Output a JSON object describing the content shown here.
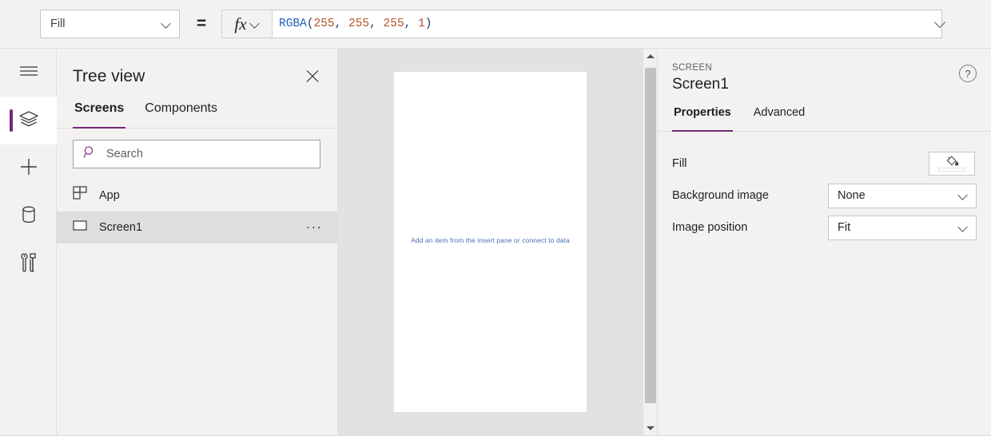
{
  "formula_bar": {
    "property_value": "Fill",
    "equals": "=",
    "fx_label": "fx",
    "formula_tokens": [
      {
        "text": "RGBA",
        "type": "fn"
      },
      {
        "text": "(",
        "type": "paren"
      },
      {
        "text": "255",
        "type": "num"
      },
      {
        "text": ", ",
        "type": "comma"
      },
      {
        "text": "255",
        "type": "num"
      },
      {
        "text": ", ",
        "type": "comma"
      },
      {
        "text": "255",
        "type": "num"
      },
      {
        "text": ", ",
        "type": "comma"
      },
      {
        "text": "1",
        "type": "num"
      },
      {
        "text": ")",
        "type": "paren"
      }
    ],
    "formula_text": "RGBA(255, 255, 255, 1)"
  },
  "rail": {
    "items": [
      {
        "icon": "hamburger-menu-icon",
        "name": "menu",
        "selected": false
      },
      {
        "icon": "layers-icon",
        "name": "tree-view",
        "selected": true
      },
      {
        "icon": "plus-icon",
        "name": "insert",
        "selected": false
      },
      {
        "icon": "database-icon",
        "name": "data",
        "selected": false
      },
      {
        "icon": "tools-icon",
        "name": "media-tools",
        "selected": false
      }
    ],
    "selection_color": "#742774"
  },
  "tree_view": {
    "title": "Tree view",
    "tabs": [
      {
        "label": "Screens",
        "active": true
      },
      {
        "label": "Components",
        "active": false
      }
    ],
    "search": {
      "placeholder": "Search",
      "value": ""
    },
    "items": [
      {
        "label": "App",
        "icon": "app-grid-icon",
        "selected": false,
        "has_menu": false
      },
      {
        "label": "Screen1",
        "icon": "screen-rect-icon",
        "selected": true,
        "has_menu": true,
        "menu_label": "..."
      }
    ]
  },
  "canvas": {
    "hint_text": "Add an item from the insert pane or connect to data",
    "hint_color": "#4871b5",
    "screen_fill": "#ffffff",
    "background": "#e3e2e1"
  },
  "properties_pane": {
    "kicker": "SCREEN",
    "title": "Screen1",
    "help_label": "?",
    "tabs": [
      {
        "label": "Properties",
        "active": true
      },
      {
        "label": "Advanced",
        "active": false
      }
    ],
    "rows": [
      {
        "label": "Fill",
        "control": "swatch",
        "value": "#ffffff"
      },
      {
        "label": "Background image",
        "control": "dropdown",
        "value": "None"
      },
      {
        "label": "Image position",
        "control": "dropdown",
        "value": "Fit"
      }
    ]
  }
}
